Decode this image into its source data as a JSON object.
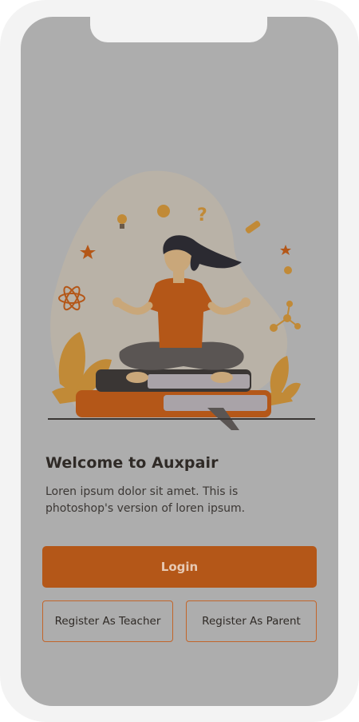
{
  "welcome": {
    "title": "Welcome to Auxpair",
    "description": "Loren ipsum dolor sit amet. This is photoshop's version of loren ipsum."
  },
  "buttons": {
    "login": "Login",
    "register_teacher": "Register As Teacher",
    "register_parent": "Register As Parent"
  },
  "colors": {
    "overlay": "#adadad",
    "accent": "#b45718",
    "accent_border": "#c2652a",
    "text_dark": "#2f2a26"
  },
  "icons": [
    "meditating-woman-illustration",
    "books-icon",
    "lightbulb-icon",
    "question-mark-icon",
    "atom-icon",
    "molecule-icon",
    "star-icon",
    "leaf-icon"
  ]
}
